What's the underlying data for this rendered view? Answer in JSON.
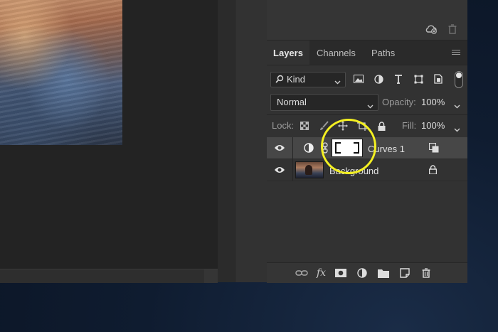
{
  "panel": {
    "tabs": [
      {
        "label": "Layers",
        "active": true
      },
      {
        "label": "Channels",
        "active": false
      },
      {
        "label": "Paths",
        "active": false
      }
    ],
    "filter": {
      "kind_label": "Kind"
    },
    "blend_mode": "Normal",
    "opacity_label": "Opacity:",
    "opacity_value": "100%",
    "lock_label": "Lock:",
    "fill_label": "Fill:",
    "fill_value": "100%",
    "layers": [
      {
        "name": "Curves 1",
        "type": "adjustment",
        "selected": true,
        "visible": true
      },
      {
        "name": "Background",
        "type": "image",
        "selected": false,
        "visible": true,
        "locked": true
      }
    ]
  },
  "colors": {
    "highlight_ring": "#f4f021",
    "panel_bg": "#323232",
    "selected_row": "#474747"
  },
  "icons": {
    "top": [
      "cloud-sync-icon",
      "trash-icon"
    ],
    "filters": [
      "image-filter-icon",
      "adjustment-filter-icon",
      "type-filter-icon",
      "shape-filter-icon",
      "smart-object-filter-icon"
    ],
    "locks": [
      "lock-transparent-icon",
      "lock-paint-icon",
      "lock-move-icon",
      "lock-artboard-icon",
      "lock-all-icon"
    ],
    "bottom": [
      "link-layers-icon",
      "fx-icon",
      "add-mask-icon",
      "new-adjustment-icon",
      "new-group-icon",
      "new-layer-icon",
      "delete-layer-icon"
    ]
  }
}
